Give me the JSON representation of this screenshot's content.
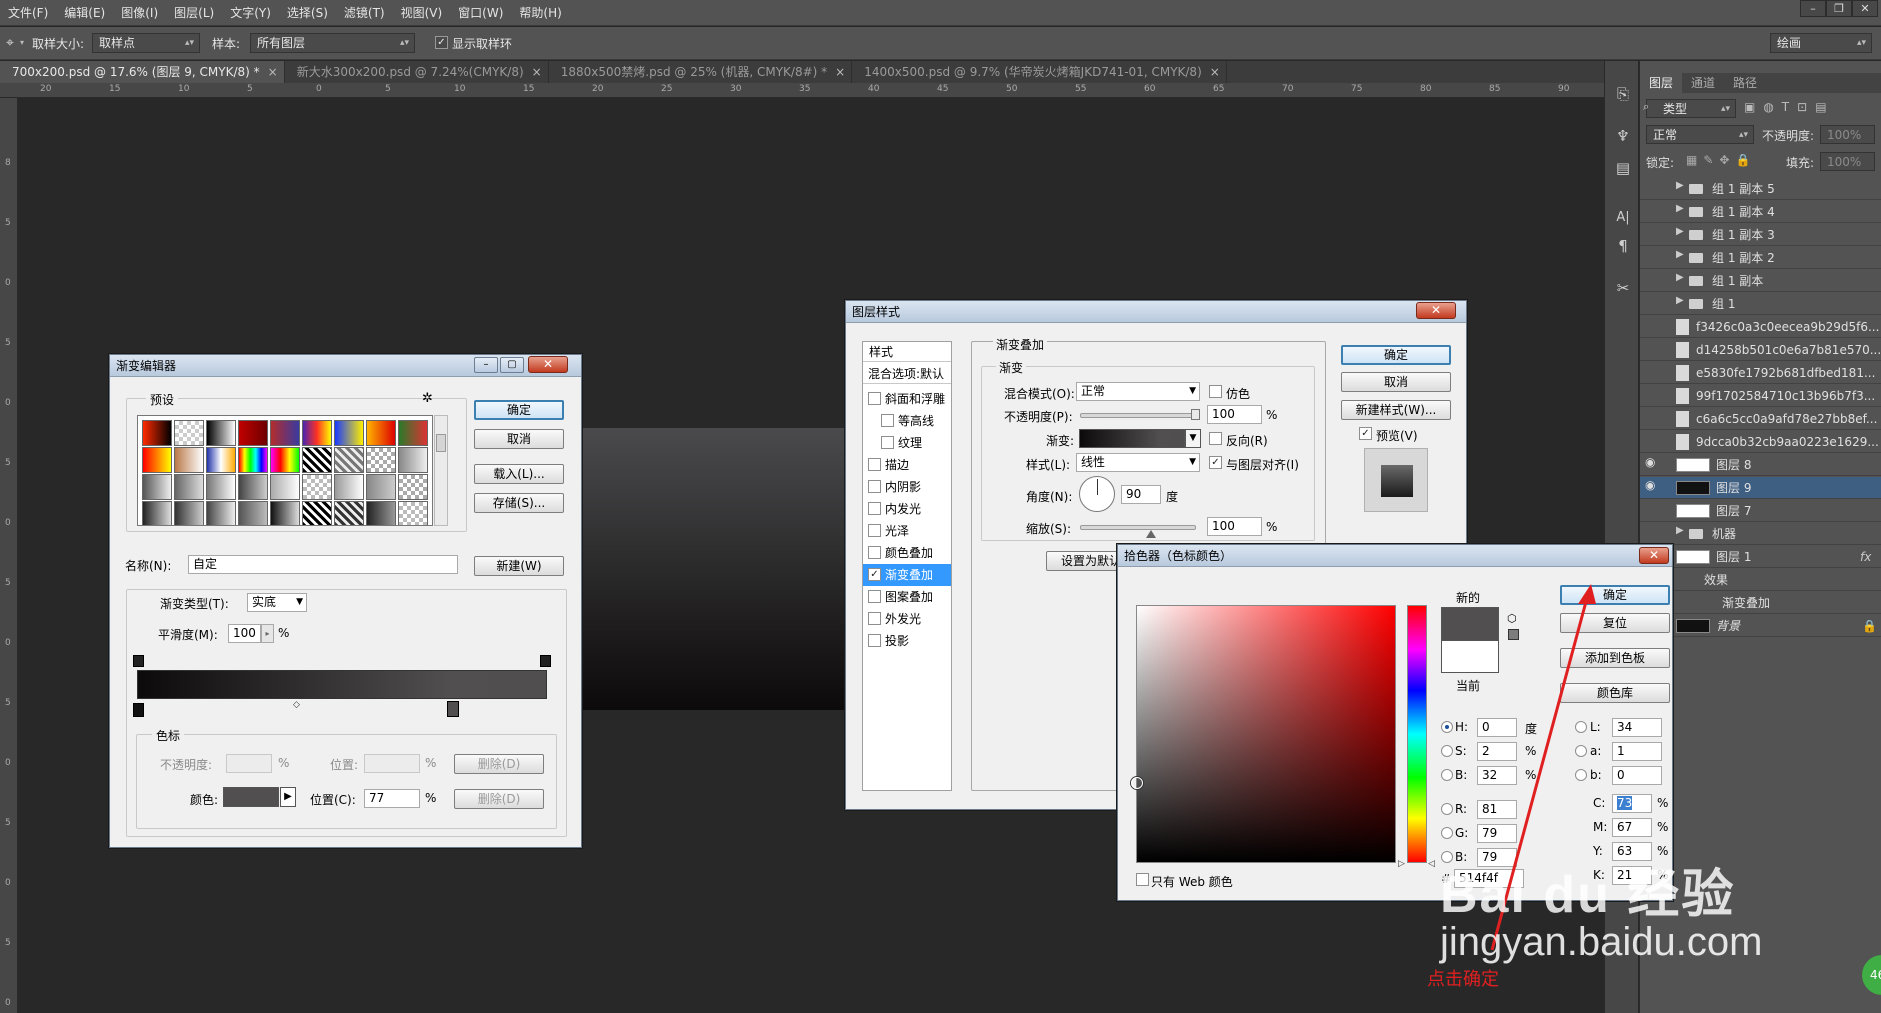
{
  "menu": [
    "文件(F)",
    "编辑(E)",
    "图像(I)",
    "图层(L)",
    "文字(Y)",
    "选择(S)",
    "滤镜(T)",
    "视图(V)",
    "窗口(W)",
    "帮助(H)"
  ],
  "options": {
    "sample_size_label": "取样大小:",
    "sample_size_value": "取样点",
    "sample_label": "样本:",
    "sample_value": "所有图层",
    "show_ring_label": "显示取样环",
    "workspace": "绘画"
  },
  "tabs": [
    {
      "label": "700x200.psd @ 17.6% (图层 9, CMYK/8) *",
      "active": true
    },
    {
      "label": "新大水300x200.psd @ 7.24%(CMYK/8)",
      "active": false
    },
    {
      "label": "1880x500禁烤.psd @ 25% (机器, CMYK/8#) *",
      "active": false
    },
    {
      "label": "1400x500.psd @ 9.7% (华帝炭火烤箱JKD741-01, CMYK/8)",
      "active": false
    }
  ],
  "ruler_h": [
    "20",
    "15",
    "10",
    "5",
    "0",
    "5",
    "10",
    "15",
    "20",
    "25",
    "30",
    "35",
    "40",
    "45",
    "50",
    "55",
    "60",
    "65",
    "70",
    "75",
    "80",
    "85",
    "90"
  ],
  "ruler_v": [
    "8",
    "5",
    "0",
    "5",
    "0",
    "5",
    "0",
    "5",
    "0",
    "5",
    "0",
    "5",
    "0",
    "5",
    "0"
  ],
  "panel": {
    "tabs": [
      "图层",
      "通道",
      "路径"
    ],
    "filter_label": "类型",
    "blend_mode": "正常",
    "opacity_label": "不透明度:",
    "opacity_value": "100%",
    "lock_label": "锁定:",
    "fill_label": "填充:",
    "fill_value": "100%",
    "layers": [
      {
        "name": "组 1 副本 5",
        "kind": "group"
      },
      {
        "name": "组 1 副本 4",
        "kind": "group"
      },
      {
        "name": "组 1 副本 3",
        "kind": "group"
      },
      {
        "name": "组 1 副本 2",
        "kind": "group"
      },
      {
        "name": "组 1 副本",
        "kind": "group"
      },
      {
        "name": "组 1",
        "kind": "group"
      },
      {
        "name": "f3426c0a3c0eecea9b29d5f6...",
        "kind": "smart"
      },
      {
        "name": "d14258b501c0e6a7b81e570...",
        "kind": "smart"
      },
      {
        "name": "e5830fe1792b681dfbed181...",
        "kind": "smart"
      },
      {
        "name": "99f1702584710c13b96b7f3...",
        "kind": "smart"
      },
      {
        "name": "c6a6c5cc0a9afd78e27bb8ef...",
        "kind": "smart"
      },
      {
        "name": "9dcca0b32cb9aa0223e1629...",
        "kind": "smart"
      },
      {
        "name": "图层 8",
        "kind": "layer"
      },
      {
        "name": "图层 9",
        "kind": "layer",
        "selected": true
      },
      {
        "name": "图层 7",
        "kind": "layer"
      },
      {
        "name": "机器",
        "kind": "group"
      },
      {
        "name": "图层 1",
        "kind": "layer",
        "fx": "fx"
      },
      {
        "name": "效果",
        "kind": "effects"
      },
      {
        "name": "渐变叠加",
        "kind": "effect-item"
      },
      {
        "name": "背景",
        "kind": "bg"
      }
    ]
  },
  "gradient_editor": {
    "title": "渐变编辑器",
    "presets_label": "预设",
    "ok": "确定",
    "cancel": "取消",
    "load": "载入(L)...",
    "save": "存储(S)...",
    "name_label": "名称(N):",
    "name_value": "自定",
    "new_button": "新建(W)",
    "type_label": "渐变类型(T):",
    "type_value": "实底",
    "smooth_label": "平滑度(M):",
    "smooth_value": "100",
    "percent": "%",
    "stops_label": "色标",
    "opacity_label": "不透明度:",
    "position_label": "位置:",
    "delete_button": "删除(D)",
    "color_label": "颜色:",
    "color_position_label": "位置(C):",
    "color_position_value": "77",
    "color_stop_position": 77
  },
  "layer_style": {
    "title": "图层样式",
    "styles_header": "样式",
    "blend_options": "混合选项:默认",
    "items": [
      {
        "label": "斜面和浮雕",
        "checked": false,
        "indent": false
      },
      {
        "label": "等高线",
        "checked": false,
        "indent": true
      },
      {
        "label": "纹理",
        "checked": false,
        "indent": true
      },
      {
        "label": "描边",
        "checked": false,
        "indent": false
      },
      {
        "label": "内阴影",
        "checked": false,
        "indent": false
      },
      {
        "label": "内发光",
        "checked": false,
        "indent": false
      },
      {
        "label": "光泽",
        "checked": false,
        "indent": false
      },
      {
        "label": "颜色叠加",
        "checked": false,
        "indent": false
      },
      {
        "label": "渐变叠加",
        "checked": true,
        "indent": false,
        "selected": true
      },
      {
        "label": "图案叠加",
        "checked": false,
        "indent": false
      },
      {
        "label": "外发光",
        "checked": false,
        "indent": false
      },
      {
        "label": "投影",
        "checked": false,
        "indent": false
      }
    ],
    "section_title": "渐变叠加",
    "subsection": "渐变",
    "blend_mode_label": "混合模式(O):",
    "blend_mode_value": "正常",
    "dither_label": "仿色",
    "opacity_label": "不透明度(P):",
    "opacity_value": "100",
    "gradient_label": "渐变:",
    "reverse_label": "反向(R)",
    "style_label": "样式(L):",
    "style_value": "线性",
    "align_label": "与图层对齐(I)",
    "angle_label": "角度(N):",
    "angle_value": "90",
    "degree": "度",
    "scale_label": "缩放(S):",
    "scale_value": "100",
    "percent": "%",
    "set_default": "设置为默认",
    "ok": "确定",
    "cancel": "取消",
    "new_style": "新建样式(W)...",
    "preview_label": "预览(V)"
  },
  "color_picker": {
    "title": "拾色器（色标颜色）",
    "ok": "确定",
    "reset": "复位",
    "add_swatch": "添加到色板",
    "library": "颜色库",
    "new_label": "新的",
    "current_label": "当前",
    "new_color": "#514f4f",
    "current_color": "#ffffff",
    "h_label": "H:",
    "h_value": "0",
    "h_unit": "度",
    "s_label": "S:",
    "s_value": "2",
    "s_unit": "%",
    "b_label": "B:",
    "b_value": "32",
    "b_unit": "%",
    "r_label": "R:",
    "r_value": "81",
    "g_label": "G:",
    "g_value": "79",
    "bl_label": "B:",
    "bl_value": "79",
    "l_label": "L:",
    "l_value": "34",
    "a_label": "a:",
    "a_value": "1",
    "lb_label": "b:",
    "lb_value": "0",
    "c_label": "C:",
    "c_value": "73",
    "m_label": "M:",
    "m_value": "67",
    "y_label": "Y:",
    "y_value": "63",
    "k_label": "K:",
    "k_value": "21",
    "pct": "%",
    "hex_label": "#",
    "hex_value": "514f4f",
    "web_only_label": "只有 Web 颜色"
  },
  "annotation": {
    "text": "点击确定",
    "color": "#e02020"
  },
  "watermark": {
    "brand": "Bai du 经验",
    "url": "jingyan.baidu.com"
  },
  "badge": "46"
}
